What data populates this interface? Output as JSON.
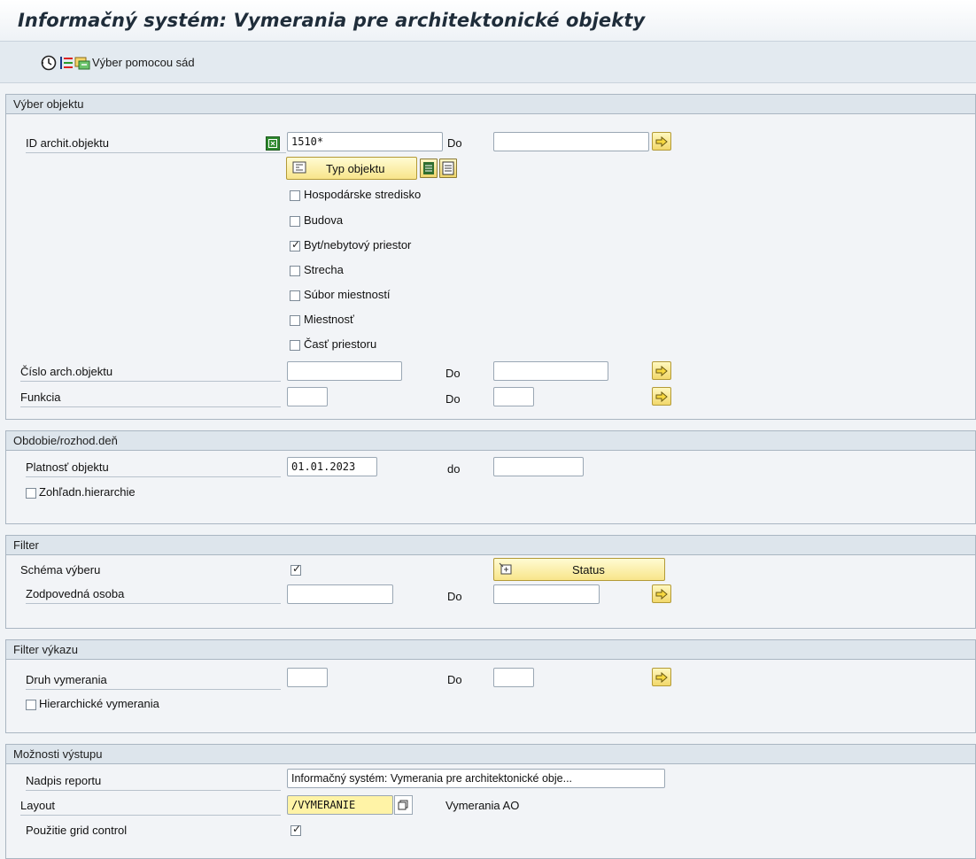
{
  "title": "Informačný systém: Vymerania pre architektonické objekty",
  "toolbar": {
    "execute_icon": "execute-clock-icon",
    "selection_options_icon": "selection-options-icon",
    "sets_icon": "sets-icon",
    "sets_label": "Výber pomocou sád"
  },
  "groups": {
    "object_selection": {
      "title": "Výber objektu",
      "id_label": "ID archit.objektu",
      "id_value": "1510*",
      "id_to_label": "Do",
      "id_to_value": "",
      "type_button": "Typ objektu",
      "types": [
        {
          "label": "Hospodárske stredisko",
          "checked": false
        },
        {
          "label": "Budova",
          "checked": false
        },
        {
          "label": "Byt/nebytový priestor",
          "checked": true
        },
        {
          "label": "Strecha",
          "checked": false
        },
        {
          "label": "Súbor miestností",
          "checked": false
        },
        {
          "label": "Miestnosť",
          "checked": false
        },
        {
          "label": "Časť priestoru",
          "checked": false
        }
      ],
      "number_label": "Číslo arch.objektu",
      "number_value": "",
      "number_to_label": "Do",
      "number_to_value": "",
      "function_label": "Funkcia",
      "function_value": "",
      "function_to_label": "Do",
      "function_to_value": ""
    },
    "period": {
      "title": "Obdobie/rozhod.deň",
      "validity_label": "Platnosť objektu",
      "validity_from": "01.01.2023",
      "validity_to_label": "do",
      "validity_to": "",
      "hierarchy_label": "Zohľadn.hierarchie",
      "hierarchy_checked": false
    },
    "filter": {
      "title": "Filter",
      "scheme_label": "Schéma výberu",
      "scheme_checked": true,
      "status_button": "Status",
      "person_label": "Zodpovedná osoba",
      "person_value": "",
      "person_to_label": "Do",
      "person_to_value": ""
    },
    "report_filter": {
      "title": "Filter výkazu",
      "type_label": "Druh vymerania",
      "type_value": "",
      "type_to_label": "Do",
      "type_to_value": "",
      "hier_label": "Hierarchické vymerania",
      "hier_checked": false
    },
    "output": {
      "title": "Možnosti výstupu",
      "heading_label": "Nadpis reportu",
      "heading_value": "Informačný systém: Vymerania pre architektonické obje...",
      "layout_label": "Layout",
      "layout_value": "/VYMERANIE",
      "layout_desc": "Vymerania AO",
      "grid_label": "Použitie grid control",
      "grid_checked": true
    }
  }
}
